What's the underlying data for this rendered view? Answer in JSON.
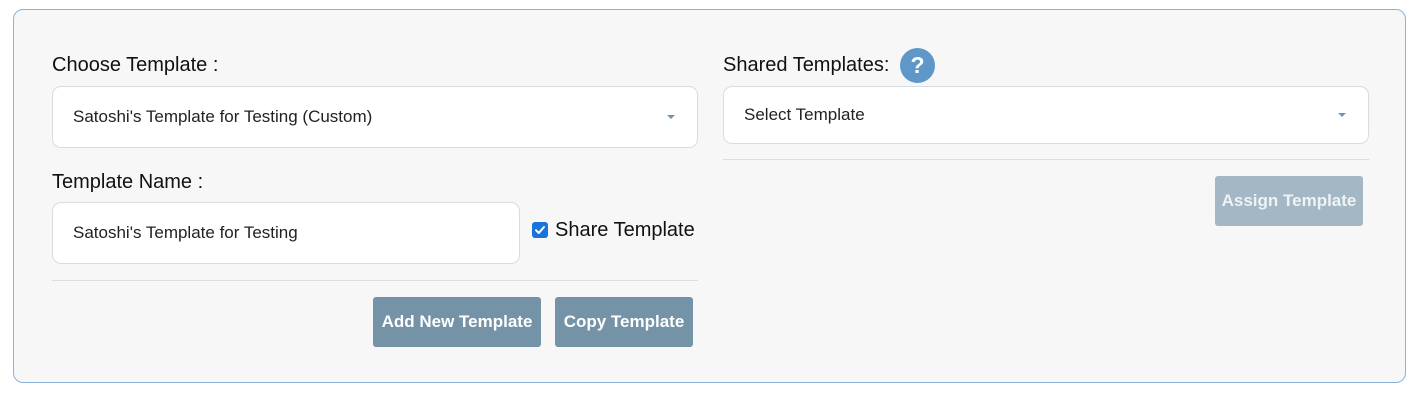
{
  "choose_template": {
    "label": "Choose Template :",
    "selected": "Satoshi's Template for Testing (Custom)",
    "caret_icon": "chevron-down-icon"
  },
  "template_name": {
    "label": "Template Name :",
    "value": "Satoshi's Template for Testing"
  },
  "share_template": {
    "label": "Share Template",
    "checked": true
  },
  "shared_templates": {
    "label": "Shared Templates:",
    "help_icon": "question-icon",
    "help_glyph": "?",
    "placeholder": "Select Template"
  },
  "actions": {
    "add_new": "Add New Template",
    "copy": "Copy Template",
    "assign": "Assign Template"
  },
  "colors": {
    "panel_border": "#8bb3dc",
    "button": "#7593a7",
    "button_disabled": "#a3b7c4",
    "help_icon": "#5f97c9",
    "checkbox": "#1a73d9"
  }
}
